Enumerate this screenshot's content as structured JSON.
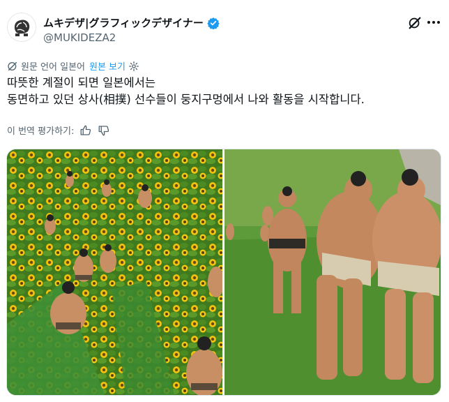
{
  "author": {
    "display_name": "ムキデザ|グラフィックデザイナー",
    "handle": "@MUKIDEZA2",
    "verified_color": "#1d9bf0"
  },
  "translation": {
    "source_language": "원문 언어 일본어",
    "show_original": "원본 보기"
  },
  "tweet": {
    "lines": [
      "따뜻한 계절이 되면 일본에서는",
      "동면하고 있던 상사(相撲) 선수들이 둥지구멍에서 나와 활동을 시작합니다."
    ]
  },
  "rate_translation": {
    "label": "이 번역 평가하기:"
  },
  "colors": {
    "text": "#0f1419",
    "secondary": "#536471",
    "link": "#1d9bf0"
  },
  "icons": {
    "grok": "grok-icon",
    "more": "more-icon",
    "globe": "globe-icon",
    "settings": "gear-icon",
    "thumbs_up": "thumbs-up-icon",
    "thumbs_down": "thumbs-down-icon"
  }
}
